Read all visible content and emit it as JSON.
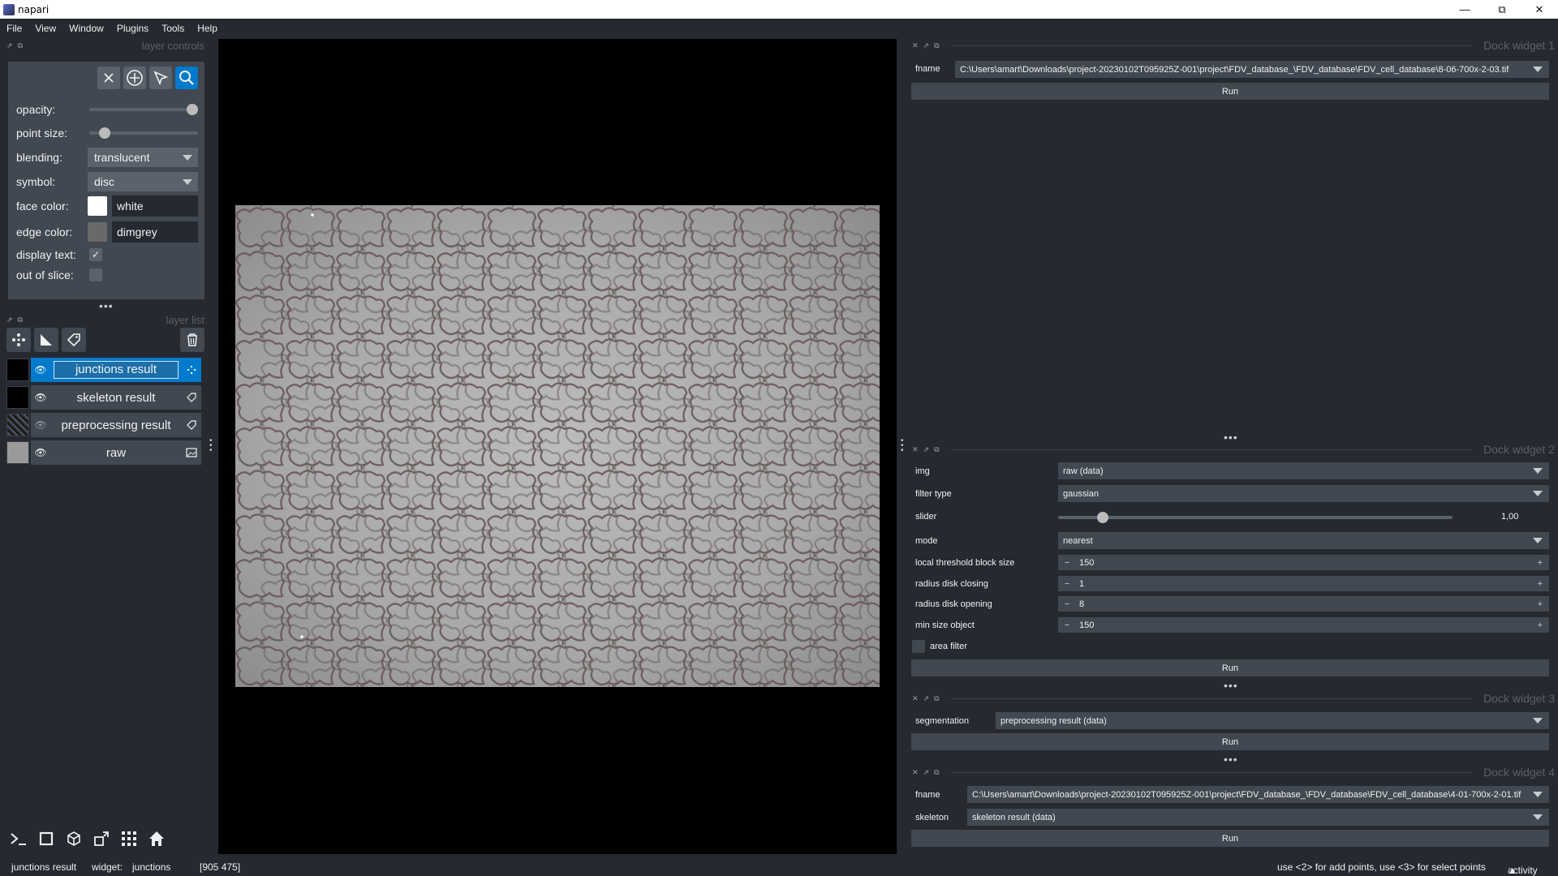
{
  "window": {
    "title": "napari",
    "controls": [
      "minimize",
      "restore",
      "close"
    ]
  },
  "menubar": [
    "File",
    "View",
    "Window",
    "Plugins",
    "Tools",
    "Help"
  ],
  "layer_controls": {
    "title": "layer controls",
    "opacity_label": "opacity:",
    "opacity_value": 1.0,
    "point_size_label": "point size:",
    "blending_label": "blending:",
    "blending_value": "translucent",
    "symbol_label": "symbol:",
    "symbol_value": "disc",
    "face_color_label": "face color:",
    "face_color_value": "white",
    "face_color_swatch": "#ffffff",
    "edge_color_label": "edge color:",
    "edge_color_value": "dimgrey",
    "edge_color_swatch": "#696969",
    "display_text_label": "display text:",
    "display_text_checked": true,
    "out_of_slice_label": "out of slice:",
    "out_of_slice_checked": false
  },
  "layer_list": {
    "title": "layer list",
    "layers": [
      {
        "name": "junctions result",
        "type": "points",
        "visible": true,
        "selected": true
      },
      {
        "name": "skeleton result",
        "type": "labels",
        "visible": true,
        "selected": false
      },
      {
        "name": "preprocessing result",
        "type": "labels",
        "visible": false,
        "selected": false
      },
      {
        "name": "raw",
        "type": "image",
        "visible": true,
        "selected": false
      }
    ]
  },
  "dock1": {
    "title": "Dock widget 1",
    "fname_label": "fname",
    "fname_value": "C:\\Users\\amart\\Downloads\\project-20230102T095925Z-001\\project\\FDV_database_\\FDV_database\\FDV_cell_database\\8-06-700x-2-03.tif",
    "run": "Run"
  },
  "dock2": {
    "title": "Dock widget 2",
    "img_label": "img",
    "img_value": "raw (data)",
    "filter_label": "filter type",
    "filter_value": "gaussian",
    "slider_label": "slider",
    "slider_value": "1,00",
    "mode_label": "mode",
    "mode_value": "nearest",
    "block_label": "local threshold block size",
    "block_value": "150",
    "closing_label": "radius disk closing",
    "closing_value": "1",
    "opening_label": "radius disk opening",
    "opening_value": "8",
    "minsize_label": "min size object",
    "minsize_value": "150",
    "area_filter_label": "area filter",
    "run": "Run"
  },
  "dock3": {
    "title": "Dock widget 3",
    "seg_label": "segmentation",
    "seg_value": "preprocessing result (data)",
    "run": "Run"
  },
  "dock4": {
    "title": "Dock widget 4",
    "fname_label": "fname",
    "fname_value": "C:\\Users\\amart\\Downloads\\project-20230102T095925Z-001\\project\\FDV_database_\\FDV_database\\FDV_cell_database\\4-01-700x-2-01.tif",
    "skeleton_label": "skeleton",
    "skeleton_value": "skeleton result (data)",
    "run": "Run"
  },
  "statusbar": {
    "layer": "junctions result",
    "widget_label": "widget:",
    "widget_value": "junctions",
    "coords": "[905 475]",
    "hint": "use <2> for add points, use <3> for select points",
    "activity": "activity"
  },
  "colors": {
    "background": "#262930",
    "panel": "#414851",
    "accent": "#007acc"
  }
}
